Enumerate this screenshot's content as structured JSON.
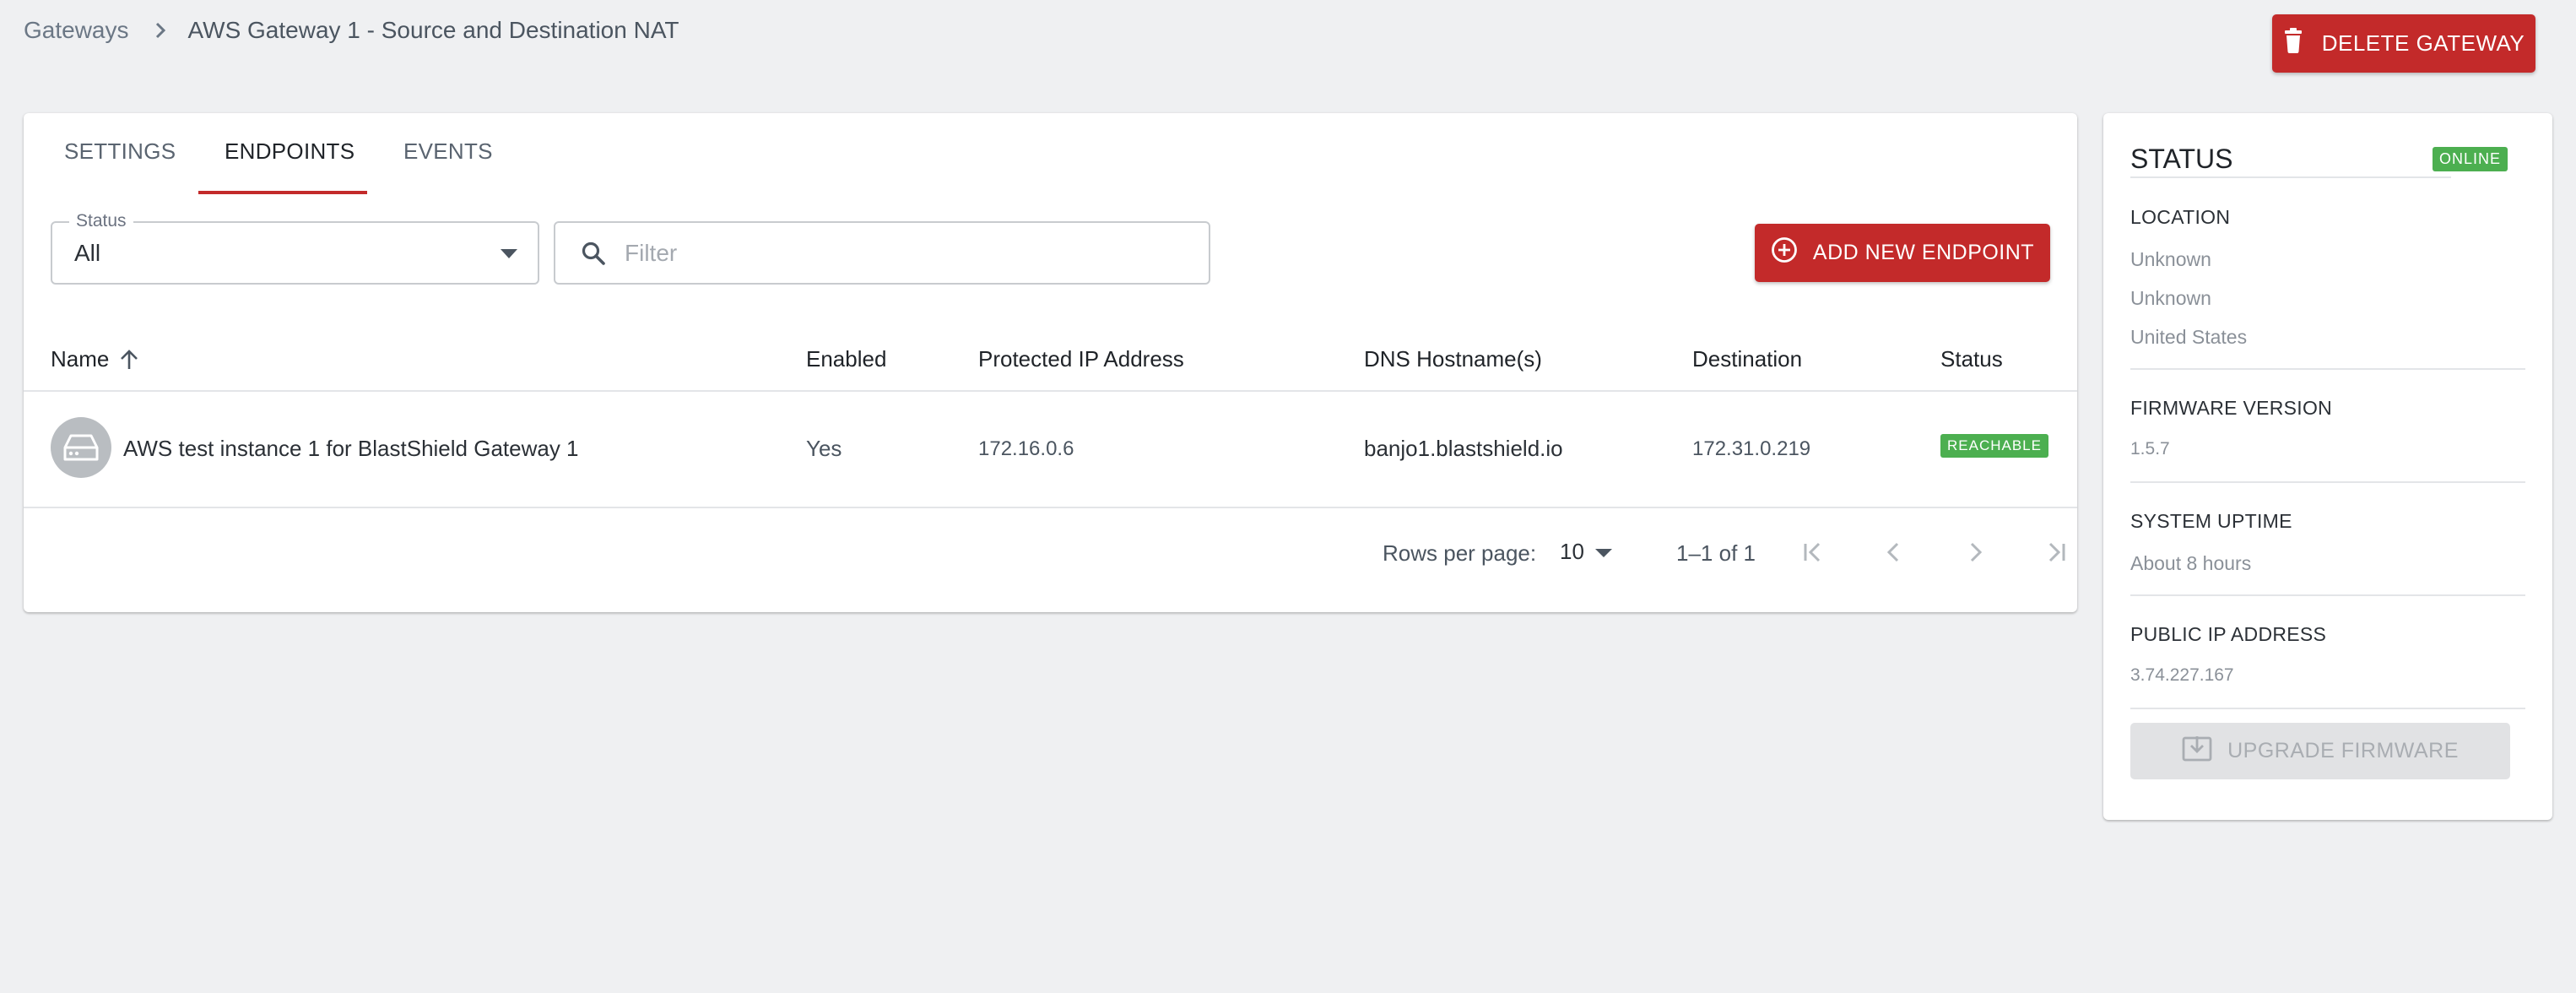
{
  "breadcrumb": {
    "parent": "Gateways",
    "current": "AWS Gateway 1 - Source and Destination NAT"
  },
  "header": {
    "delete_label": "DELETE GATEWAY"
  },
  "tabs": [
    {
      "label": "SETTINGS",
      "active": false
    },
    {
      "label": "ENDPOINTS",
      "active": true
    },
    {
      "label": "EVENTS",
      "active": false
    }
  ],
  "filters": {
    "status_label": "Status",
    "status_value": "All",
    "filter_placeholder": "Filter",
    "add_label": "ADD NEW ENDPOINT"
  },
  "table": {
    "columns": [
      "Name",
      "Enabled",
      "Protected IP Address",
      "DNS Hostname(s)",
      "Destination",
      "Status"
    ],
    "rows": [
      {
        "name": "AWS test instance 1 for BlastShield Gateway 1",
        "enabled": "Yes",
        "protected_ip": "172.16.0.6",
        "dns": "banjo1.blastshield.io",
        "destination": "172.31.0.219",
        "status": "REACHABLE"
      }
    ]
  },
  "pagination": {
    "rows_per_page_label": "Rows per page:",
    "rows_per_page": "10",
    "range": "1–1 of 1"
  },
  "status_panel": {
    "title": "STATUS",
    "badge": "ONLINE",
    "location_label": "LOCATION",
    "location_lines": [
      "Unknown",
      "Unknown",
      "United States"
    ],
    "firmware_label": "FIRMWARE VERSION",
    "firmware_value": "1.5.7",
    "uptime_label": "SYSTEM UPTIME",
    "uptime_value": "About 8 hours",
    "public_ip_label": "PUBLIC IP ADDRESS",
    "public_ip_value": "3.74.227.167",
    "upgrade_label": "UPGRADE FIRMWARE"
  },
  "colors": {
    "accent": "#c32a2a",
    "success": "#4caf50",
    "background": "#eff0f2"
  }
}
